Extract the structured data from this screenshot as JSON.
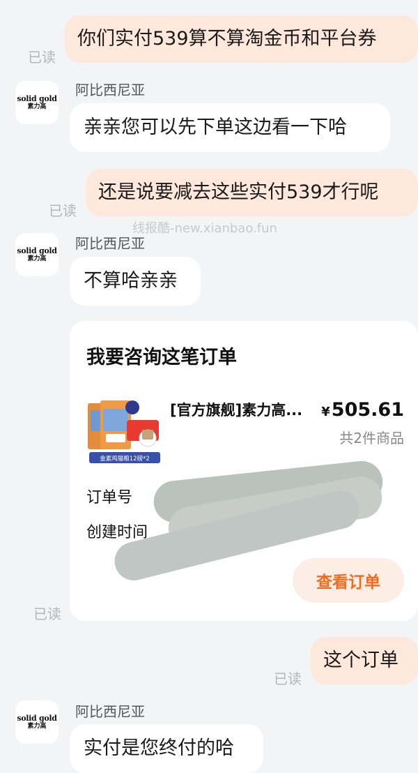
{
  "merchant": {
    "name": "阿比西尼亚",
    "avatar_line1": "solid gold",
    "avatar_line2": "素力高"
  },
  "read_label": "已读",
  "watermark": "线报酷-new.xianbao.fun",
  "messages": [
    {
      "from": "me",
      "text": "你们实付539算不算淘金币和平台券"
    },
    {
      "from": "merchant",
      "text": "亲亲您可以先下单这边看一下哈"
    },
    {
      "from": "me",
      "text": "还是说要减去这些实付539才行呢"
    },
    {
      "from": "merchant",
      "text": "不算哈亲亲"
    },
    {
      "from": "me",
      "text": "这个订单"
    },
    {
      "from": "merchant",
      "text": "实付是您终付的哈"
    }
  ],
  "order_card": {
    "title": "我要咨询这笔订单",
    "product_name": "[官方旗舰]素力高...",
    "currency": "¥",
    "price": "505.61",
    "item_count": "共2件商品",
    "thumb_caption": "金素鸡猫粮12磅*2",
    "order_no_label": "订单号",
    "created_label": "创建时间",
    "view_button": "查看订单"
  }
}
